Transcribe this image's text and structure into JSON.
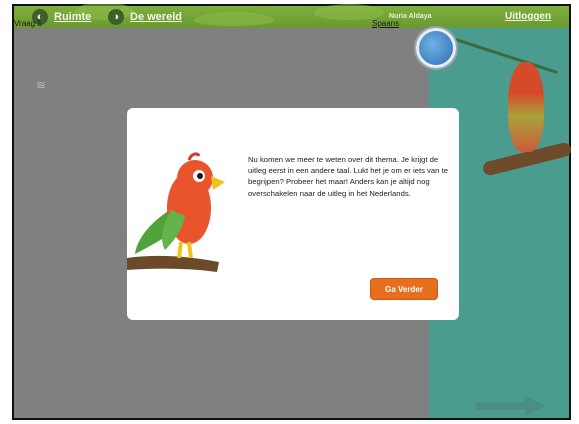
{
  "header": {
    "nav": [
      {
        "label": "Ruimte",
        "icon": "globe-icon"
      },
      {
        "label": "De wereld",
        "icon": "world-icon"
      }
    ],
    "user_name": "Nuria Aldaya",
    "logout_label": "Uitloggen"
  },
  "question": {
    "label": "Vraag 5",
    "language_link": "Spaans"
  },
  "dialog": {
    "message": "Nu komen we meer te weten over dit thema. Je krijgt de uitleg eerst in een andere taal. Lukt het je om er iets van te begrijpen? Probeer het maar! Anders kan je altijd nog overschakelen naar de uitleg in het Nederlands.",
    "button_label": "Ga Verder"
  },
  "colors": {
    "header": "#7fae3f",
    "content": "#808080",
    "side_panel": "#4a9c8f",
    "button": "#e66e1e"
  }
}
